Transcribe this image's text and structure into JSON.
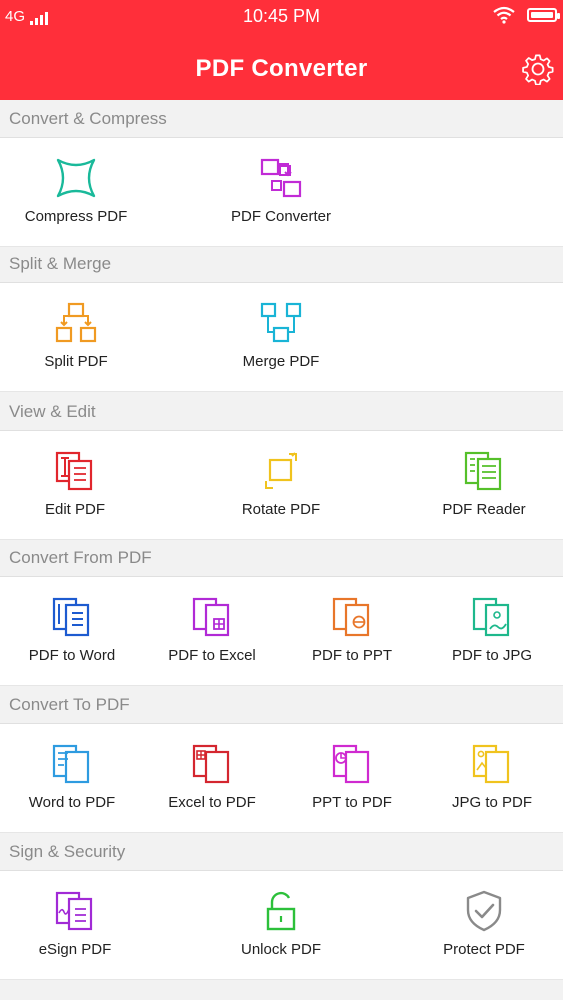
{
  "status_bar": {
    "network": "4G",
    "time": "10:45 PM"
  },
  "header": {
    "title": "PDF Converter"
  },
  "sections": [
    {
      "title": "Convert & Compress",
      "items": [
        {
          "label": "Compress PDF",
          "icon": "compress-icon",
          "color": "#19b99a"
        },
        {
          "label": "PDF Converter",
          "icon": "convert-icon",
          "color": "#c12bd6"
        }
      ]
    },
    {
      "title": "Split & Merge",
      "items": [
        {
          "label": "Split PDF",
          "icon": "split-icon",
          "color": "#f09a22"
        },
        {
          "label": "Merge PDF",
          "icon": "merge-icon",
          "color": "#19b4d6"
        }
      ]
    },
    {
      "title": "View & Edit",
      "items": [
        {
          "label": "Edit PDF",
          "icon": "edit-icon",
          "color": "#e1262d"
        },
        {
          "label": "Rotate PDF",
          "icon": "rotate-icon",
          "color": "#f0c31e"
        },
        {
          "label": "PDF Reader",
          "icon": "reader-icon",
          "color": "#55c02a"
        }
      ]
    },
    {
      "title": "Convert From PDF",
      "items": [
        {
          "label": "PDF to Word",
          "icon": "word-icon",
          "color": "#1d5bd0"
        },
        {
          "label": "PDF to Excel",
          "icon": "excel-icon",
          "color": "#b12ad6"
        },
        {
          "label": "PDF to PPT",
          "icon": "ppt-icon",
          "color": "#e8762a"
        },
        {
          "label": "PDF to JPG",
          "icon": "jpg-icon",
          "color": "#1eb88c"
        }
      ]
    },
    {
      "title": "Convert To PDF",
      "items": [
        {
          "label": "Word to PDF",
          "icon": "word-to-pdf-icon",
          "color": "#2e9be0"
        },
        {
          "label": "Excel to PDF",
          "icon": "excel-to-pdf-icon",
          "color": "#d4262f"
        },
        {
          "label": "PPT to PDF",
          "icon": "ppt-to-pdf-icon",
          "color": "#cf2ad0"
        },
        {
          "label": "JPG to PDF",
          "icon": "jpg-to-pdf-icon",
          "color": "#f0c31e"
        }
      ]
    },
    {
      "title": "Sign & Security",
      "items": [
        {
          "label": "eSign PDF",
          "icon": "esign-icon",
          "color": "#a12ad6"
        },
        {
          "label": "Unlock PDF",
          "icon": "unlock-icon",
          "color": "#2cc03a"
        },
        {
          "label": "Protect PDF",
          "icon": "shield-icon",
          "color": "#8a8a8a"
        }
      ]
    }
  ]
}
